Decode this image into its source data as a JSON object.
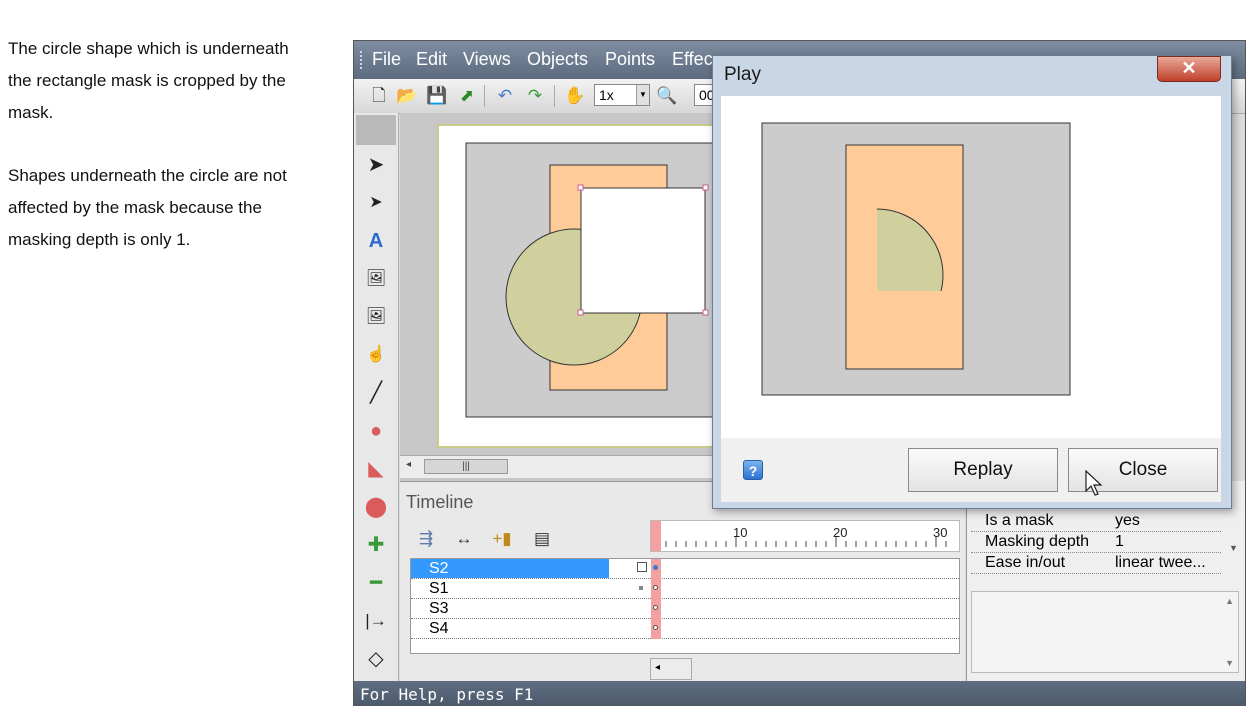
{
  "doc": {
    "para1": [
      "The circle shape which is underneath",
      "the rectangle mask is cropped by the",
      "mask."
    ],
    "para2": [
      "Shapes underneath the circle are not",
      "affected by the mask because the",
      "masking depth is only 1."
    ]
  },
  "app": {
    "menu": [
      "File",
      "Edit",
      "Views",
      "Objects",
      "Points",
      "Effec"
    ],
    "toolbar": {
      "zoom": "1x",
      "frame_partial": "00"
    },
    "timeline": {
      "title": "Timeline",
      "ruler": [
        "10",
        "20",
        "30"
      ],
      "layers": [
        "S2",
        "S1",
        "S3",
        "S4"
      ]
    },
    "properties": [
      {
        "key": "Is a mask",
        "value": "yes"
      },
      {
        "key": "Masking depth",
        "value": "1"
      },
      {
        "key": "Ease in/out",
        "value": "linear twee..."
      }
    ],
    "status": "For Help, press F1"
  },
  "dialog": {
    "title": "Play",
    "close_glyph": "✕",
    "help_glyph": "?",
    "replay_label": "Replay",
    "close_label": "Close"
  },
  "colors": {
    "stage_gray": "#cccccc",
    "peach": "#ffcc99",
    "sage": "#d0d09e",
    "selection_blue": "#3399ff",
    "playhead_red": "#f2a0a0"
  }
}
